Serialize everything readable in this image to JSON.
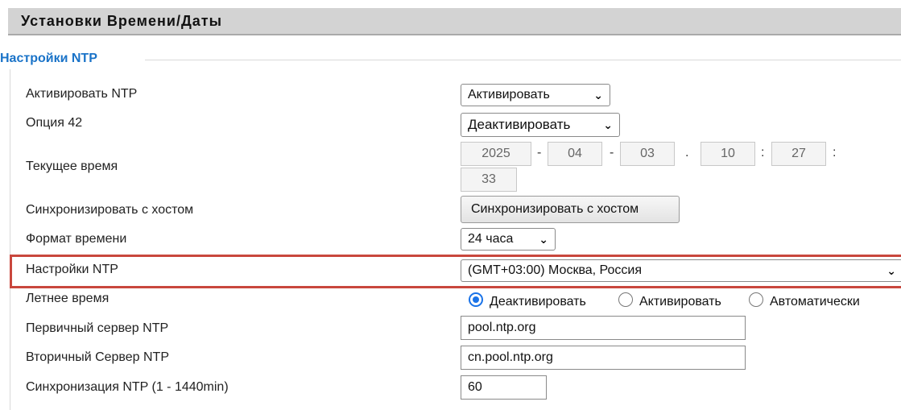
{
  "header": {
    "title": "Установки Времени/Даты"
  },
  "section": {
    "legend": "Настройки NTP"
  },
  "rows": {
    "enable_ntp": {
      "label": "Активировать NTP",
      "value": "Активировать"
    },
    "option42": {
      "label": "Опция 42",
      "value": "Деактивировать"
    },
    "current_time": {
      "label": "Текущее время",
      "year": "2025",
      "month": "04",
      "day": "03",
      "hour": "10",
      "minute": "27",
      "second": "33",
      "sep_dash": "-",
      "sep_dot": ".",
      "sep_colon": ":"
    },
    "sync_host": {
      "label": "Синхронизировать с хостом",
      "button": "Синхронизировать с хостом"
    },
    "time_format": {
      "label": "Формат времени",
      "value": "24 часа"
    },
    "timezone": {
      "label": "Настройки NTP",
      "value": "(GMT+03:00) Москва, Россия"
    },
    "dst": {
      "label": "Летнее время",
      "options": [
        "Деактивировать",
        "Активировать",
        "Автоматически"
      ],
      "selected": "Деактивировать"
    },
    "primary_ntp": {
      "label": "Первичный сервер NTP",
      "value": "pool.ntp.org"
    },
    "secondary_ntp": {
      "label": "Вторичный Сервер NTP",
      "value": "cn.pool.ntp.org"
    },
    "sync_interval": {
      "label": "Синхронизация NTP (1 - 1440min)",
      "value": "60"
    }
  },
  "icons": {
    "dropdown": "chevron-down-icon"
  },
  "colors": {
    "accent": "#1a73c8",
    "highlight": "#c9473d",
    "header_bg": "#d3d3d3"
  }
}
